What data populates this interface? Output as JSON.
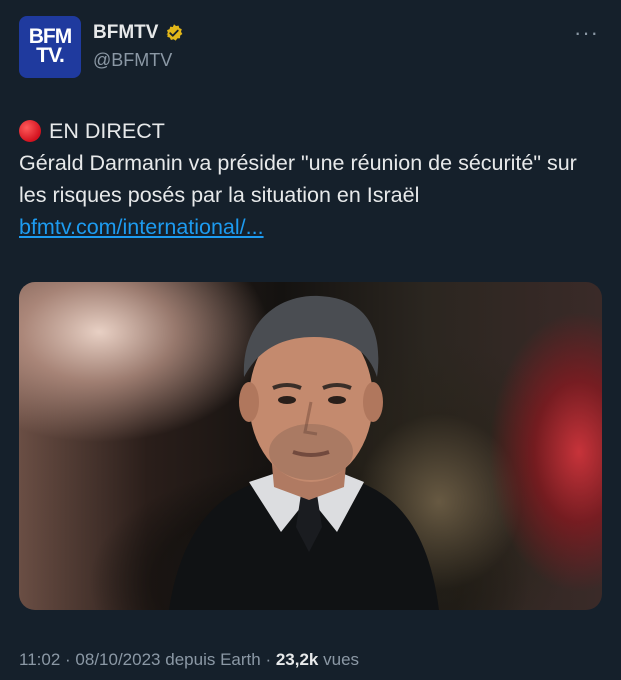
{
  "tweet": {
    "author": {
      "display_name": "BFMTV",
      "handle": "@BFMTV",
      "avatar_line1": "BFM",
      "avatar_line2": "TV."
    },
    "more_icon": "···",
    "live_label": "EN DIRECT",
    "body": "Gérald Darmanin va présider \"une réunion de sécurité\" sur les risques posés par la situation en Israël",
    "link_text": "bfmtv.com/international/...",
    "meta": {
      "time": "11:02",
      "separator1": "·",
      "date": "08/10/2023",
      "source": "depuis Earth",
      "separator2": "·",
      "views_count": "23,2k",
      "views_label": "vues"
    }
  },
  "icons": {
    "verified": "gold-verified-badge",
    "live": "red-circle"
  },
  "colors": {
    "background": "#15202b",
    "link": "#1d9bf0",
    "secondary": "#8b98a5",
    "verified": "#e2b719"
  }
}
